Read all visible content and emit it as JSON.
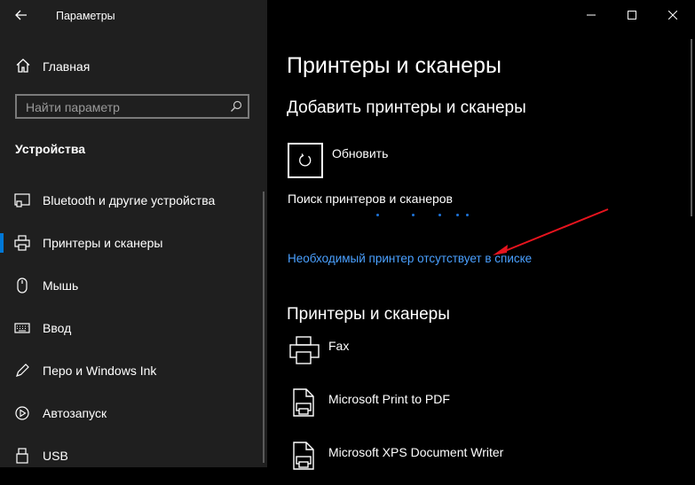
{
  "window": {
    "title": "Параметры"
  },
  "sidebar": {
    "home_label": "Главная",
    "search_placeholder": "Найти параметр",
    "section_title": "Устройства",
    "items": [
      {
        "label": "Bluetooth и другие устройства",
        "icon": "bluetooth-devices-icon"
      },
      {
        "label": "Принтеры и сканеры",
        "icon": "printer-icon",
        "selected": true
      },
      {
        "label": "Мышь",
        "icon": "mouse-icon"
      },
      {
        "label": "Ввод",
        "icon": "keyboard-icon"
      },
      {
        "label": "Перо и Windows Ink",
        "icon": "pen-icon"
      },
      {
        "label": "Автозапуск",
        "icon": "autoplay-icon"
      },
      {
        "label": "USB",
        "icon": "usb-icon"
      }
    ]
  },
  "main": {
    "title": "Принтеры и сканеры",
    "add_section": {
      "heading": "Добавить принтеры и сканеры",
      "refresh_label": "Обновить",
      "searching_text": "Поиск принтеров и сканеров",
      "missing_printer_link": "Необходимый принтер отсутствует в списке"
    },
    "printers_section": {
      "heading": "Принтеры и сканеры",
      "printers": [
        {
          "name": "Fax"
        },
        {
          "name": "Microsoft Print to PDF"
        },
        {
          "name": "Microsoft XPS Document Writer"
        }
      ]
    }
  },
  "colors": {
    "accent": "#0078d7",
    "link": "#4aa0ff",
    "annotation_arrow": "#e8141e"
  }
}
